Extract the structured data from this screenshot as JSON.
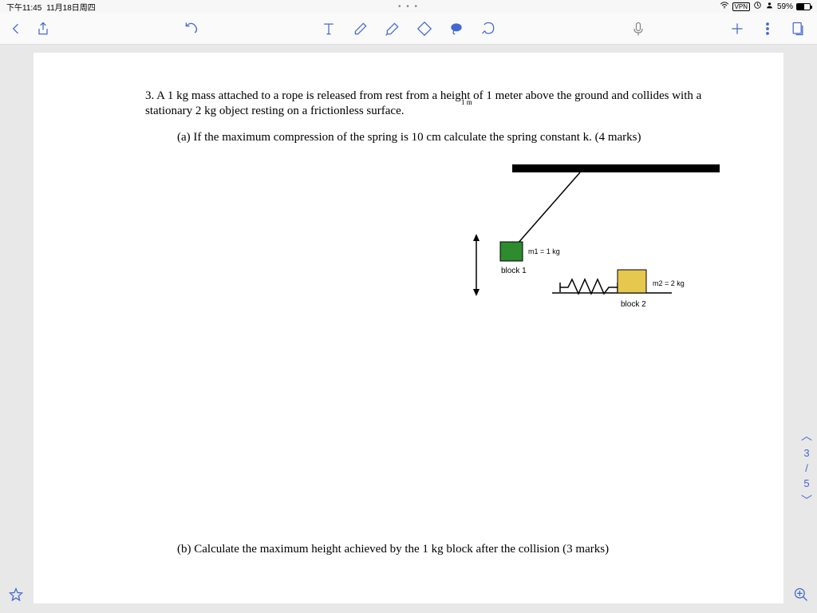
{
  "status": {
    "time": "下午11:45",
    "date": "11月18日周四",
    "center_dots": "• • •",
    "vpn": "VPN",
    "battery_pct": "59%"
  },
  "question": {
    "main": "3.  A 1 kg mass attached to a rope is released from rest from a height of 1 meter above the ground and collides with a stationary 2 kg object resting on a frictionless surface.",
    "one_m": "1 m",
    "part_a": "(a) If the maximum compression of the spring is 10 cm calculate the spring constant k. (4 marks)",
    "part_b": "(b) Calculate the maximum height achieved by the 1 kg block after the collision (3 marks)"
  },
  "diagram": {
    "m1_label": "m1 = 1 kg",
    "m2_label": "m2 = 2 kg",
    "block1": "block 1",
    "block2": "block 2"
  },
  "pager": {
    "cur": "3",
    "sep": "/",
    "total": "5"
  },
  "colors": {
    "accent": "#4169d1",
    "block1": "#2e8b2e",
    "block2": "#e6c84f"
  }
}
